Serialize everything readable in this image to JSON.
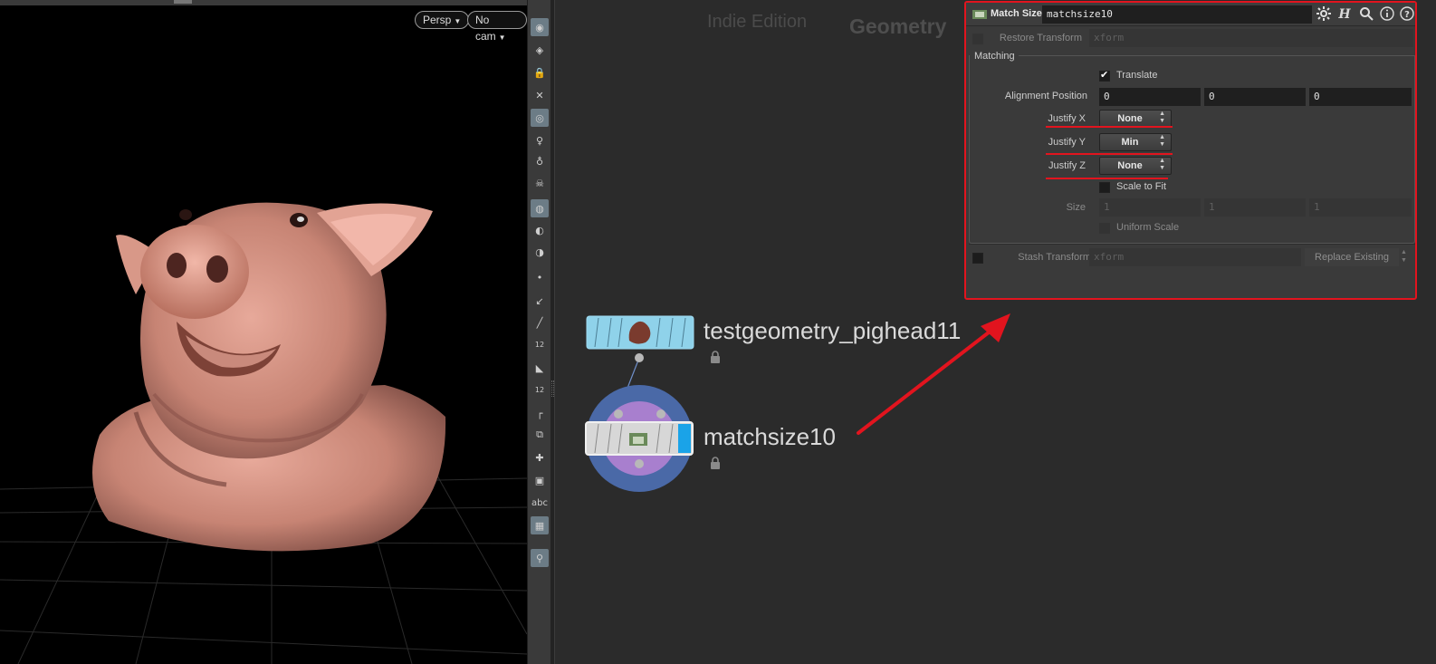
{
  "viewport": {
    "persp_label": "Persp",
    "cam_label": "No cam"
  },
  "shelf": {
    "icons": [
      "view-icon",
      "select-icon",
      "lock-icon",
      "ghost-icon",
      "shading-icon",
      "light-icon",
      "light-add-icon",
      "light-skull-icon",
      "display-icon",
      "camera-icon",
      "camera-settings-icon",
      "point-icon",
      "brush-icon",
      "pin-icon",
      "point-number-icon",
      "paint-icon",
      "primitive-number-icon",
      "corner-icon",
      "snap-icon",
      "transform-icon",
      "frame-icon",
      "text-icon",
      "background-icon",
      "location-icon"
    ],
    "text_label": "abc",
    "num_label": "12"
  },
  "network": {
    "edition": "Indie Edition",
    "context": "Geometry",
    "nodes": [
      {
        "name": "testgeometry_pighead11"
      },
      {
        "name": "matchsize10"
      }
    ]
  },
  "params": {
    "node_type": "Match Size",
    "node_name": "matchsize10",
    "restore_transform_label": "Restore Transform",
    "restore_transform_placeholder": "xform",
    "folder_label": "Matching",
    "translate_label": "Translate",
    "alignment_position_label": "Alignment Position",
    "alignment_position": [
      "0",
      "0",
      "0"
    ],
    "justify_x_label": "Justify X",
    "justify_x": "None",
    "justify_y_label": "Justify Y",
    "justify_y": "Min",
    "justify_z_label": "Justify Z",
    "justify_z": "None",
    "scale_to_fit_label": "Scale to Fit",
    "size_label": "Size",
    "size": [
      "1",
      "1",
      "1"
    ],
    "uniform_scale_label": "Uniform Scale",
    "stash_transform_label": "Stash Transform",
    "stash_transform_placeholder": "xform",
    "replace_existing_label": "Replace Existing"
  },
  "annotation_color": "#e2141e"
}
